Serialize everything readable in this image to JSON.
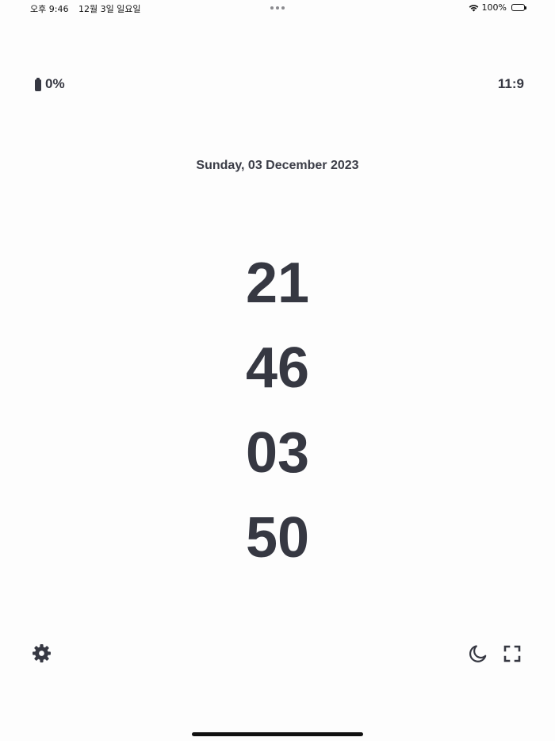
{
  "status_bar": {
    "time": "오후 9:46",
    "date": "12월 3일 일요일",
    "battery_percent": "100%",
    "battery_level": 1.0,
    "icons": [
      "multitask-dots-icon",
      "wifi-icon",
      "battery-icon"
    ]
  },
  "app": {
    "battery_text": "0%",
    "battery_icon": "battery-icon",
    "aspect_label": "11:9",
    "date_text": "Sunday, 03 December 2023",
    "clock": {
      "hours": "21",
      "minutes": "46",
      "seconds": "03",
      "centiseconds": "50"
    },
    "toolbar": {
      "settings_icon": "gear-icon",
      "night_mode_icon": "moon-icon",
      "fullscreen_icon": "fullscreen-icon"
    },
    "text_color": "#363842",
    "background_color": "#fdfdfd"
  }
}
